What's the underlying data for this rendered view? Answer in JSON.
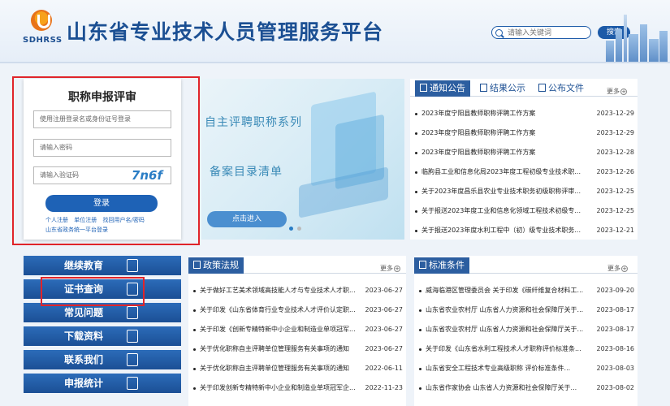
{
  "header": {
    "logo_text": "SDHRSS",
    "title": "山东省专业技术人员管理服务平台",
    "search_placeholder": "请输入关键词",
    "search_button": "搜索"
  },
  "login": {
    "title": "职称申报评审",
    "username_placeholder": "使用注册登录名或身份证号登录",
    "password_placeholder": "请输入密码",
    "captcha_placeholder": "请输入验证码",
    "captcha_code": "7n6f",
    "login_button": "登录",
    "link_personal_register": "个人注册",
    "link_unit_register": "单位注册",
    "link_recover": "找回用户名/密码",
    "link_sso": "山东省政务统一平台登录"
  },
  "banner": {
    "line1": "自主评聘职称系列",
    "line2": "备案目录清单",
    "enter_button": "点击进入"
  },
  "notice": {
    "tabs": [
      "通知公告",
      "结果公示",
      "公布文件"
    ],
    "more": "更多",
    "items": [
      {
        "title": "2023年度宁阳县教师职称评聘工作方案",
        "date": "2023-12-29"
      },
      {
        "title": "2023年度宁阳县教师职称评聘工作方案",
        "date": "2023-12-29"
      },
      {
        "title": "2023年度宁阳县教师职称评聘工作方案",
        "date": "2023-12-28"
      },
      {
        "title": "临朐县工业和信息化局2023年度工程初级专业技术职...",
        "date": "2023-12-26"
      },
      {
        "title": "关于2023年度昌乐县农业专业技术职务初级职称评审...",
        "date": "2023-12-25"
      },
      {
        "title": "关于报送2023年度工业和信息化领域工程技术初级专...",
        "date": "2023-12-25"
      },
      {
        "title": "关于报送2023年度水利工程中（初）级专业技术职务...",
        "date": "2023-12-21"
      }
    ]
  },
  "menu": {
    "items": [
      "继续教育",
      "证书查询",
      "常见问题",
      "下载资料",
      "联系我们",
      "申报统计"
    ]
  },
  "policy": {
    "title": "政策法规",
    "more": "更多",
    "items": [
      {
        "title": "关于做好工艺美术领域高技能人才与专业技术人才职...",
        "date": "2023-06-27"
      },
      {
        "title": "关于印发《山东省体育行业专业技术人才评价认定职...",
        "date": "2023-06-27"
      },
      {
        "title": "关于印发《创新专精特新中小企业和制造业单项冠军...",
        "date": "2023-06-27"
      },
      {
        "title": "关于优化职称自主评聘单位管理服务有关事项的通知",
        "date": "2023-06-27"
      },
      {
        "title": "关于优化职称自主评聘单位管理服务有关事项的通知",
        "date": "2022-06-11"
      },
      {
        "title": "关于印发创新专精特新中小企业和制造业单项冠军企...",
        "date": "2022-11-23"
      }
    ]
  },
  "standards": {
    "title": "标准条件",
    "more": "更多",
    "items": [
      {
        "title": "威海临港区管理委员会 关于印发《碳纤维复合材料工...",
        "date": "2023-09-20"
      },
      {
        "title": "山东省农业农村厅 山东省人力资源和社会保障厅关于...",
        "date": "2023-08-17"
      },
      {
        "title": "山东省农业农村厅 山东省人力资源和社会保障厅关于...",
        "date": "2023-08-17"
      },
      {
        "title": "关于印发《山东省水利工程技术人才职称评价标准条...",
        "date": "2023-08-16"
      },
      {
        "title": "山东省安全工程技术专业高级职称 评价标准条件...",
        "date": "2023-08-03"
      },
      {
        "title": "山东省作家协会 山东省人力资源和社会保障厅关于...",
        "date": "2023-08-02"
      }
    ]
  }
}
